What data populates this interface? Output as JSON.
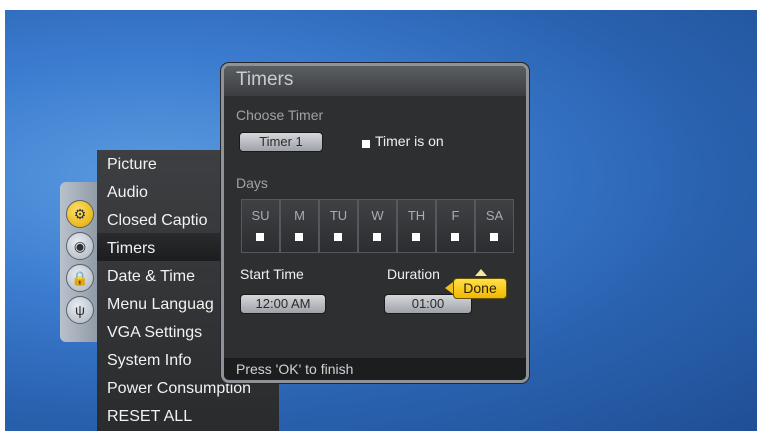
{
  "menu": {
    "items": [
      {
        "label": "Picture"
      },
      {
        "label": "Audio"
      },
      {
        "label": "Closed Captio"
      },
      {
        "label": "Timers"
      },
      {
        "label": "Date & Time"
      },
      {
        "label": "Menu Languag"
      },
      {
        "label": "VGA Settings"
      },
      {
        "label": "System Info"
      },
      {
        "label": "Power Consumption"
      },
      {
        "label": "RESET ALL"
      }
    ],
    "selected_index": 3
  },
  "rail_icons": [
    "settings-icon",
    "broadcast-icon",
    "lock-icon",
    "tree-icon"
  ],
  "timers": {
    "title": "Timers",
    "choose_timer_label": "Choose Timer",
    "timer_select": "Timer 1",
    "timer_on_label": "Timer is on",
    "days_label": "Days",
    "days": [
      "SU",
      "M",
      "TU",
      "W",
      "TH",
      "F",
      "SA"
    ],
    "start_time_label": "Start Time",
    "start_time_value": "12:00 AM",
    "duration_label": "Duration",
    "duration_value": "01:00",
    "done_label": "Done",
    "footer_hint": "Press 'OK' to finish"
  },
  "colors": {
    "accent": "#f0b800",
    "background": "#2e62b0"
  }
}
